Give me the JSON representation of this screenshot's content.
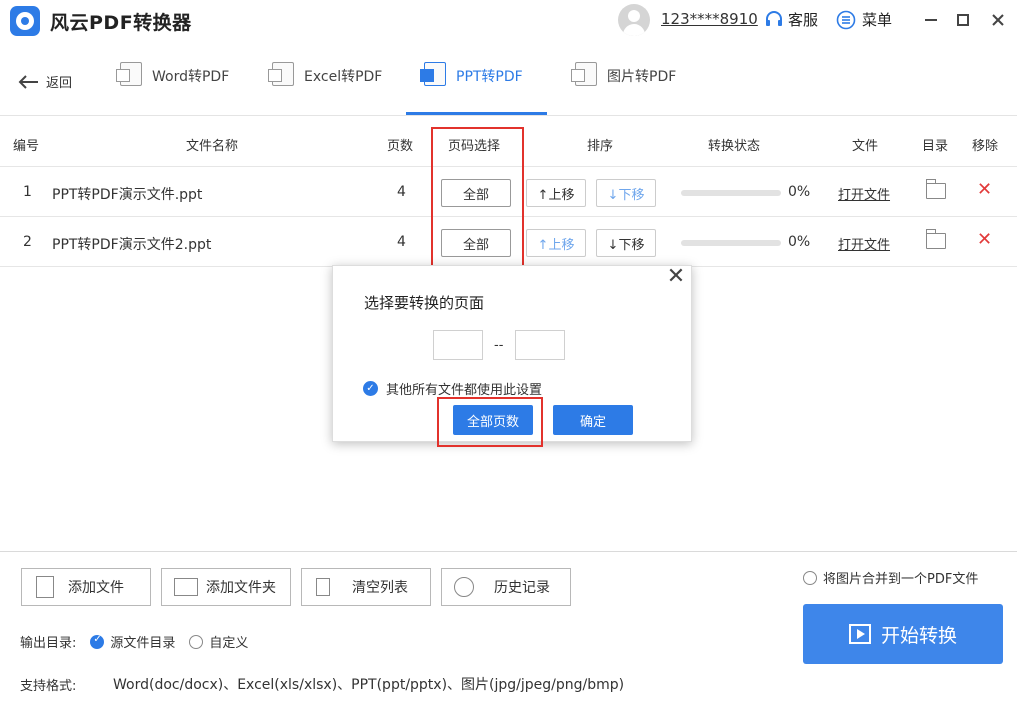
{
  "app": {
    "title": "风云PDF转换器"
  },
  "header": {
    "user": "123****8910",
    "service": "客服",
    "menu": "菜单"
  },
  "nav": {
    "back": "返回",
    "tabs": [
      {
        "label": "Word转PDF",
        "active": false
      },
      {
        "label": "Excel转PDF",
        "active": false
      },
      {
        "label": "PPT转PDF",
        "active": true
      },
      {
        "label": "图片转PDF",
        "active": false
      }
    ]
  },
  "table": {
    "headers": [
      "编号",
      "文件名称",
      "页数",
      "页码选择",
      "排序",
      "转换状态",
      "文件",
      "目录",
      "移除"
    ],
    "rows": [
      {
        "index": "1",
        "name": "PPT转PDF演示文件.ppt",
        "pages": "4",
        "page_select": "全部",
        "move_up": "↑上移",
        "move_down": "↓下移",
        "progress": 0,
        "status": "0%",
        "open": "打开文件"
      },
      {
        "index": "2",
        "name": "PPT转PDF演示文件2.ppt",
        "pages": "4",
        "page_select": "全部",
        "move_up": "↑上移",
        "move_down": "↓下移",
        "progress": 0,
        "status": "0%",
        "open": "打开文件"
      }
    ]
  },
  "dialog": {
    "title": "选择要转换的页面",
    "from_value": "",
    "to_value": "",
    "separator": "--",
    "apply_all_label": "其他所有文件都使用此设置",
    "all_pages_button": "全部页数",
    "confirm_button": "确定"
  },
  "bottom": {
    "buttons": [
      "添加文件",
      "添加文件夹",
      "清空列表",
      "历史记录"
    ],
    "merge_label": "将图片合并到一个PDF文件",
    "output_label": "输出目录:",
    "output_options": [
      {
        "label": "源文件目录",
        "selected": true
      },
      {
        "label": "自定义",
        "selected": false
      }
    ],
    "formats_label": "支持格式:",
    "formats_value": "Word(doc/docx)、Excel(xls/xlsx)、PPT(ppt/pptx)、图片(jpg/jpeg/png/bmp)",
    "start_button": "开始转换"
  },
  "colors": {
    "accent": "#2d7be6",
    "highlight": "#e2322c",
    "remove": "#e23a3a"
  }
}
